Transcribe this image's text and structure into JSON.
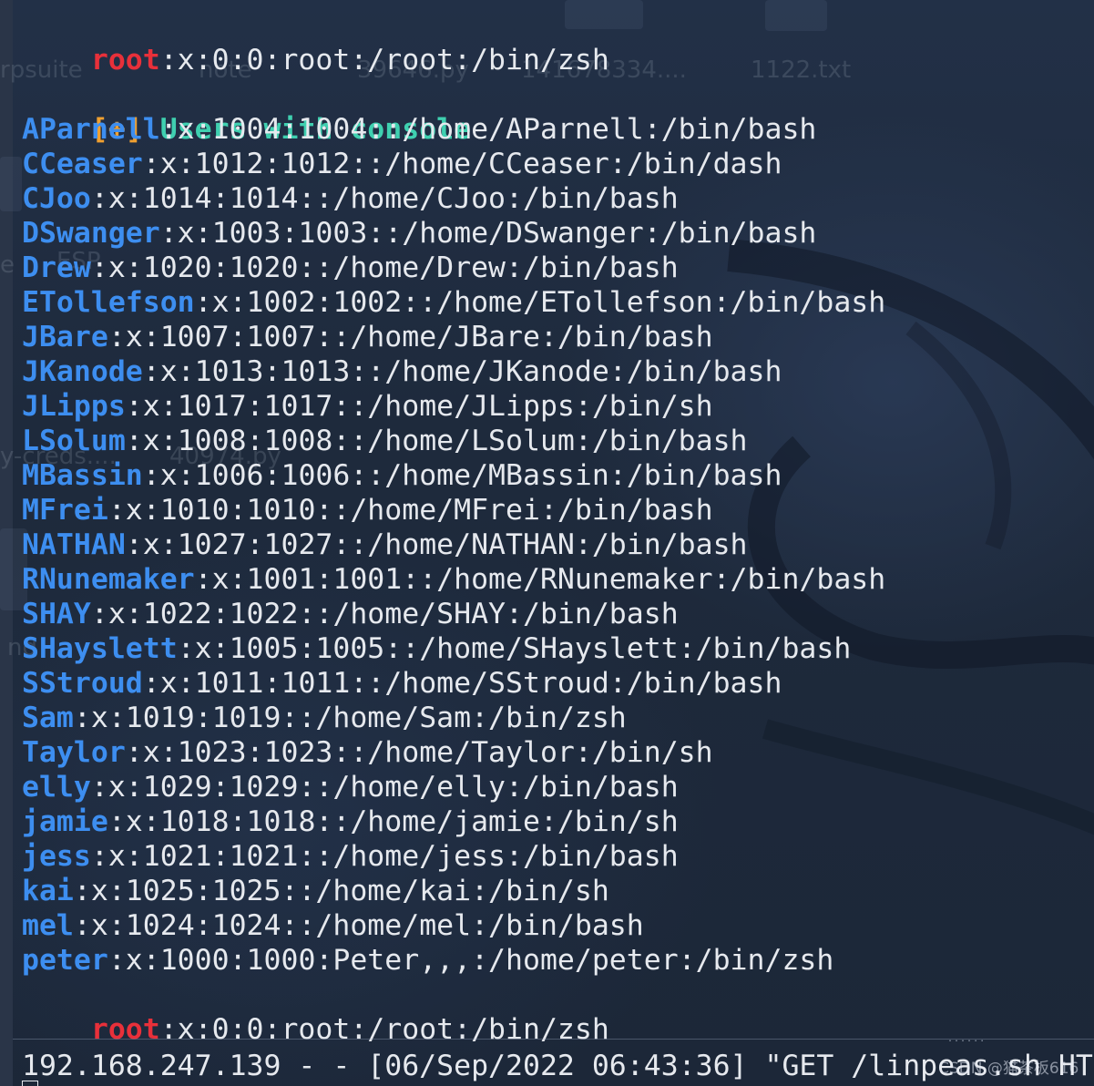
{
  "background_desktop": {
    "ghost_labels": [
      "rpsuite",
      "note",
      "39646.py",
      "141678334....",
      "1122.txt",
      "e",
      "ESP",
      "y-creds....",
      "40974.py",
      "nd"
    ]
  },
  "terminal": {
    "top_line": {
      "user": "root",
      "rest": ":x:0:0:root:/root:/bin/zsh"
    },
    "section_header": {
      "bracket": "[+]",
      "title": "Users with console"
    },
    "users": [
      {
        "user": "AParnell",
        "rest": ":x:1004:1004::/home/AParnell:/bin/bash"
      },
      {
        "user": "CCeaser",
        "rest": ":x:1012:1012::/home/CCeaser:/bin/dash"
      },
      {
        "user": "CJoo",
        "rest": ":x:1014:1014::/home/CJoo:/bin/bash"
      },
      {
        "user": "DSwanger",
        "rest": ":x:1003:1003::/home/DSwanger:/bin/bash"
      },
      {
        "user": "Drew",
        "rest": ":x:1020:1020::/home/Drew:/bin/bash"
      },
      {
        "user": "ETollefson",
        "rest": ":x:1002:1002::/home/ETollefson:/bin/bash"
      },
      {
        "user": "JBare",
        "rest": ":x:1007:1007::/home/JBare:/bin/bash"
      },
      {
        "user": "JKanode",
        "rest": ":x:1013:1013::/home/JKanode:/bin/bash"
      },
      {
        "user": "JLipps",
        "rest": ":x:1017:1017::/home/JLipps:/bin/sh"
      },
      {
        "user": "LSolum",
        "rest": ":x:1008:1008::/home/LSolum:/bin/bash"
      },
      {
        "user": "MBassin",
        "rest": ":x:1006:1006::/home/MBassin:/bin/bash"
      },
      {
        "user": "MFrei",
        "rest": ":x:1010:1010::/home/MFrei:/bin/bash"
      },
      {
        "user": "NATHAN",
        "rest": ":x:1027:1027::/home/NATHAN:/bin/bash"
      },
      {
        "user": "RNunemaker",
        "rest": ":x:1001:1001::/home/RNunemaker:/bin/bash"
      },
      {
        "user": "SHAY",
        "rest": ":x:1022:1022::/home/SHAY:/bin/bash"
      },
      {
        "user": "SHayslett",
        "rest": ":x:1005:1005::/home/SHayslett:/bin/bash"
      },
      {
        "user": "SStroud",
        "rest": ":x:1011:1011::/home/SStroud:/bin/bash"
      },
      {
        "user": "Sam",
        "rest": ":x:1019:1019::/home/Sam:/bin/zsh"
      },
      {
        "user": "Taylor",
        "rest": ":x:1023:1023::/home/Taylor:/bin/sh"
      },
      {
        "user": "elly",
        "rest": ":x:1029:1029::/home/elly:/bin/bash"
      },
      {
        "user": "jamie",
        "rest": ":x:1018:1018::/home/jamie:/bin/sh"
      },
      {
        "user": "jess",
        "rest": ":x:1021:1021::/home/jess:/bin/bash"
      },
      {
        "user": "kai",
        "rest": ":x:1025:1025::/home/kai:/bin/sh"
      },
      {
        "user": "mel",
        "rest": ":x:1024:1024::/home/mel:/bin/bash"
      },
      {
        "user": "peter",
        "rest": ":x:1000:1000:Peter,,,:/home/peter:/bin/zsh"
      }
    ],
    "root_line": {
      "user": "root",
      "rest": ":x:0:0:root:/root:/bin/zsh"
    },
    "bottom_pane": {
      "log_line": "192.168.247.139 - - [06/Sep/2022 06:43:36] \"GET /linpeas.sh HT",
      "scroll_indicator": "......"
    }
  },
  "watermark": "CSDN @猫茶板616",
  "colors": {
    "user_blue": "#3d8ef0",
    "root_red": "#e8303a",
    "bracket_orange": "#f0a030",
    "title_teal": "#3fd0b0",
    "text": "#e6e9ee"
  }
}
